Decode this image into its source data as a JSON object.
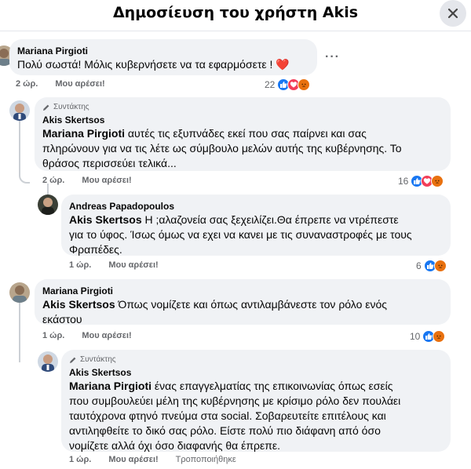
{
  "header": {
    "title": "Δημοσίευση του χρήστη Akis"
  },
  "comments": [
    {
      "author": "Mariana Pirgioti",
      "text": "Πολύ σωστά! Μόλις κυβερνήσετε να τα εφαρμόσετε ! ❤️",
      "time": "2 ώρ.",
      "like": "Μου αρέσει!",
      "reactions": "22",
      "more": "···"
    },
    {
      "tag": "Συντάκτης",
      "author": "Akis Skertsos",
      "mention": "Mariana Pirgioti",
      "line1": " αυτές τις εξυπνάδες εκεί που σας παίρνει και σας",
      "line2": "πληρώνουν για να τις λέτε ως σύμβουλο μελών αυτής της κυβέρνησης. Το",
      "line3": "θράσος περισσεύει τελικά...",
      "time": "2 ώρ.",
      "like": "Μου αρέσει!",
      "reactions": "16",
      "more": "···"
    },
    {
      "author": "Andreas Papadopoulos",
      "mention": "Akis Skertsos",
      "line1": " Η ;αλαζονεία σας ξεχειλίζει.Θα έπρεπε να ντρέπεστε",
      "line2": "για το ύφος. Ίσως όμως να εχει να κανει με τις συναναστροφές με τους",
      "line3": "Φραπέδες.",
      "time": "1 ώρ.",
      "like": "Μου αρέσει!",
      "reactions": "6",
      "more": "···"
    },
    {
      "author": "Mariana Pirgioti",
      "mention": "Akis Skertsos",
      "line1": " Όπως νομίζετε και όπως αντιλαμβάνεστε τον ρόλο ενός",
      "line2": "εκάστου",
      "time": "1 ώρ.",
      "like": "Μου αρέσει!",
      "reactions": "10",
      "more": "···"
    },
    {
      "tag": "Συντάκτης",
      "author": "Akis Skertsos",
      "mention": "Mariana Pirgioti",
      "line1": " ένας επαγγελματίας της επικοινωνίας όπως εσείς",
      "line2": "που συμβουλεύει μέλη της κυβέρνησης με κρίσιμο ρόλο δεν πουλάει",
      "line3": "ταυτόχρονα φτηνό πνεύμα στα social. Σοβαρευτείτε επιτέλους και",
      "line4": "αντιληφθείτε το δικό σας ρόλο. Είστε πολύ πιο διάφανη από όσο",
      "line5": "νομίζετε αλλά όχι όσο διαφανής θα έπρεπε.",
      "time": "1 ώρ.",
      "like": "Μου αρέσει!",
      "edited": "Τροποποιήθηκε"
    }
  ],
  "colors": {
    "like": "#1877f2",
    "love": "#f33e58",
    "angry": "#f7b125",
    "bubble": "#f0f2f5",
    "meta": "#65676b"
  }
}
